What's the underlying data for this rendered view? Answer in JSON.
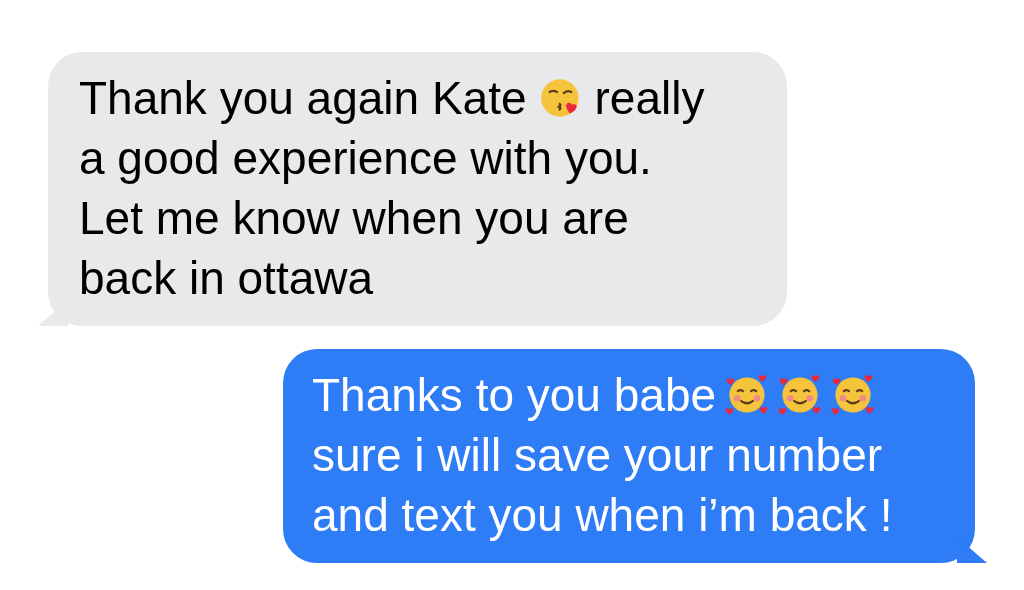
{
  "messages": [
    {
      "kind": "received",
      "lines": [
        [
          {
            "kind": "text",
            "text": "Thank you again Kate"
          },
          {
            "kind": "kiss"
          },
          {
            "kind": "text",
            "text": "really"
          }
        ],
        [
          {
            "kind": "text",
            "text": "a good experience with you."
          }
        ],
        [
          {
            "kind": "text",
            "text": "Let me know when you are"
          }
        ],
        [
          {
            "kind": "text",
            "text": "back in ottawa"
          }
        ]
      ]
    },
    {
      "kind": "sent",
      "lines": [
        [
          {
            "kind": "text",
            "text": "Thanks to you babe"
          },
          {
            "kind": "hearts"
          },
          {
            "kind": "hearts"
          },
          {
            "kind": "hearts"
          }
        ],
        [
          {
            "kind": "text",
            "text": "sure i will save your number"
          }
        ],
        [
          {
            "kind": "text",
            "text": "and text you when i’m back !"
          }
        ]
      ]
    }
  ]
}
